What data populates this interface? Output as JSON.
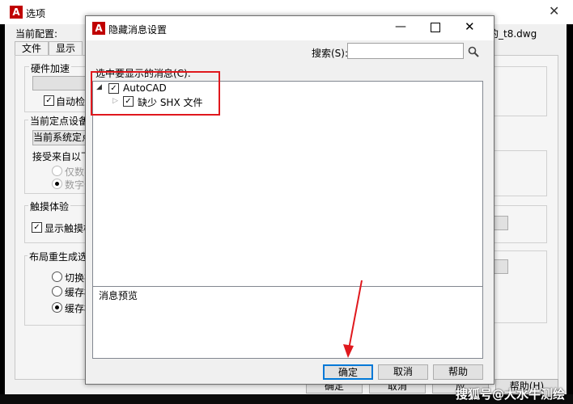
{
  "options_window": {
    "title": "选项",
    "current_profile_label": "当前配置:",
    "drawing_name_fragment": "的_t8.dwg",
    "tabs": [
      "文件",
      "显示"
    ],
    "hardware_group": "硬件加速",
    "auto_check_fragment": "自动检",
    "pointing_group": "当前定点设备",
    "pointing_fragment_char": "(",
    "pointing_dropdown_fragment": "当前系统定点",
    "accept_input_fragment": "接受来自以下",
    "radio_digitizer_only": "仅数字",
    "radio_digitizer_mouse": "数字化",
    "touch_group": "触摸体验",
    "touch_checkbox_fragment": "显示触摸模",
    "layout_regen_group": "布局重生成选项",
    "layout_radio_1": "切换布",
    "layout_radio_2": "缓存模",
    "layout_radio_3": "缓存模",
    "buttons": {
      "ok": "确定",
      "cancel": "取消",
      "apply": "应",
      "help": "帮助(H)"
    }
  },
  "dialog": {
    "title": "隐藏消息设置",
    "search_label": "搜索(S):",
    "search_value": "",
    "list_label": "选中要显示的消息(C):",
    "tree": [
      {
        "label": "AutoCAD",
        "checked": true,
        "expanded": true,
        "children": [
          {
            "label": "缺少 SHX 文件",
            "checked": true
          }
        ]
      }
    ],
    "preview_label": "消息预览",
    "buttons": {
      "ok": "确定",
      "cancel": "取消",
      "help": "帮助"
    }
  },
  "watermark": "搜狐号@大水牛测绘",
  "colors": {
    "annotation_red": "#e0181d",
    "accent_blue": "#0078d7",
    "autocad_red": "#c00000"
  }
}
